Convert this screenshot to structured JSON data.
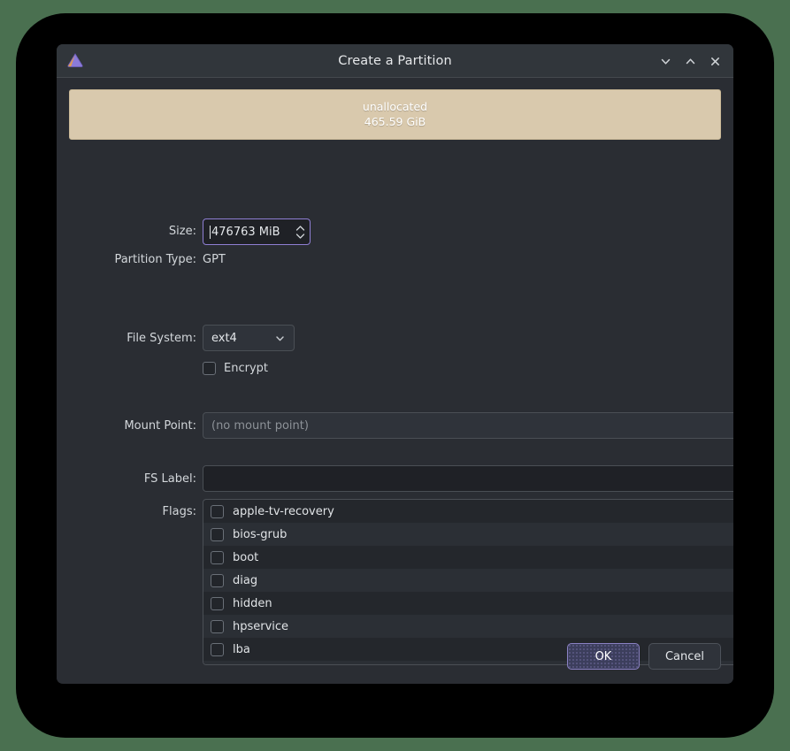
{
  "window": {
    "title": "Create a Partition",
    "app_icon": "gparted-triangle-icon",
    "controls": {
      "minimize": "chevron-down-icon",
      "maximize": "chevron-up-icon",
      "close": "close-icon"
    }
  },
  "partition_preview": {
    "name": "unallocated",
    "size": "465.59 GiB",
    "color": "#d9c9ad"
  },
  "form": {
    "size": {
      "label": "Size:",
      "value": "476763 MiB",
      "focused": true
    },
    "partition_type": {
      "label": "Partition Type:",
      "value": "GPT"
    },
    "file_system": {
      "label": "File System:",
      "value": "ext4"
    },
    "encrypt": {
      "label": "Encrypt",
      "checked": false
    },
    "mount_point": {
      "label": "Mount Point:",
      "placeholder": "(no mount point)"
    },
    "fs_label": {
      "label": "FS Label:",
      "value": "",
      "placeholder": ""
    },
    "flags": {
      "label": "Flags:",
      "items": [
        {
          "name": "apple-tv-recovery",
          "checked": false
        },
        {
          "name": "bios-grub",
          "checked": false
        },
        {
          "name": "boot",
          "checked": false
        },
        {
          "name": "diag",
          "checked": false
        },
        {
          "name": "hidden",
          "checked": false
        },
        {
          "name": "hpservice",
          "checked": false
        },
        {
          "name": "lba",
          "checked": false
        }
      ]
    }
  },
  "footer": {
    "ok_label": "OK",
    "cancel_label": "Cancel"
  },
  "colors": {
    "desktop_background": "#4a7050",
    "window_background": "#2a2d33",
    "titlebar_background": "#31363b",
    "accent_focus": "#8f7fd4",
    "unallocated": "#d9c9ad"
  }
}
